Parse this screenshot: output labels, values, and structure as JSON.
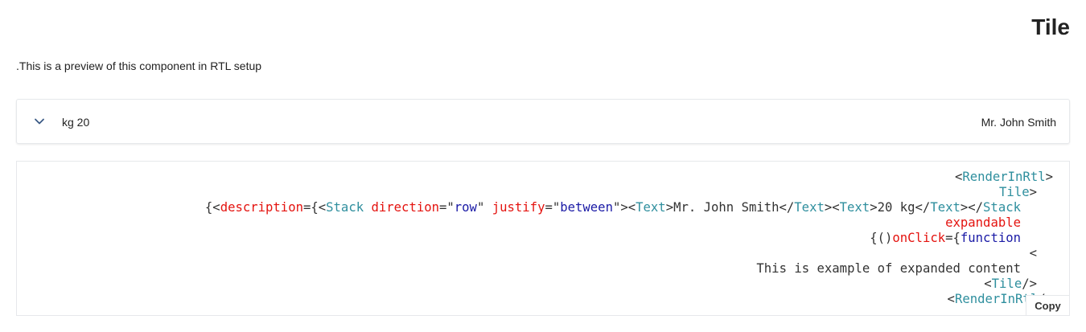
{
  "header": {
    "title": "Tile",
    "description": ".This is a preview of this component in RTL setup"
  },
  "tile": {
    "weight": "kg 20",
    "name": "Mr. John Smith",
    "chevron_icon": "chevron-down-icon"
  },
  "code": {
    "l1_open": "<",
    "l1_tag": "RenderInRtl",
    "l1_close": ">",
    "l2_tag": "Tile",
    "l2_close": ">",
    "l3_a": "{<",
    "l3_attr": "description",
    "l3_b": "={<",
    "l3_stack": "Stack",
    "l3_sp1": " ",
    "l3_dir": "direction",
    "l3_eq1": "=\"",
    "l3_row": "row",
    "l3_q1": "\" ",
    "l3_just": "justify",
    "l3_eq2": "=\"",
    "l3_between": "between",
    "l3_c": "\"><",
    "l3_text1": "Text",
    "l3_d": ">Mr. John Smith</",
    "l3_text2": "Text",
    "l3_e": "><",
    "l3_text3": "Text",
    "l3_f": ">20 kg</",
    "l3_text4": "Text",
    "l3_g": "></",
    "l3_stack2": "Stack",
    "l4_expandable": "expandable",
    "l5_a": "{()",
    "l5_onclick": "onClick",
    "l5_b": "={",
    "l5_function": "function",
    "l6_text": "<",
    "l7_text": "This is example of expanded content",
    "l8_a": "<",
    "l8_tag": "Tile",
    "l8_b": "/>",
    "l9_a": "<",
    "l9_tag": "RenderInRtl",
    "l9_b": "/>",
    "copy_label": "Copy"
  }
}
